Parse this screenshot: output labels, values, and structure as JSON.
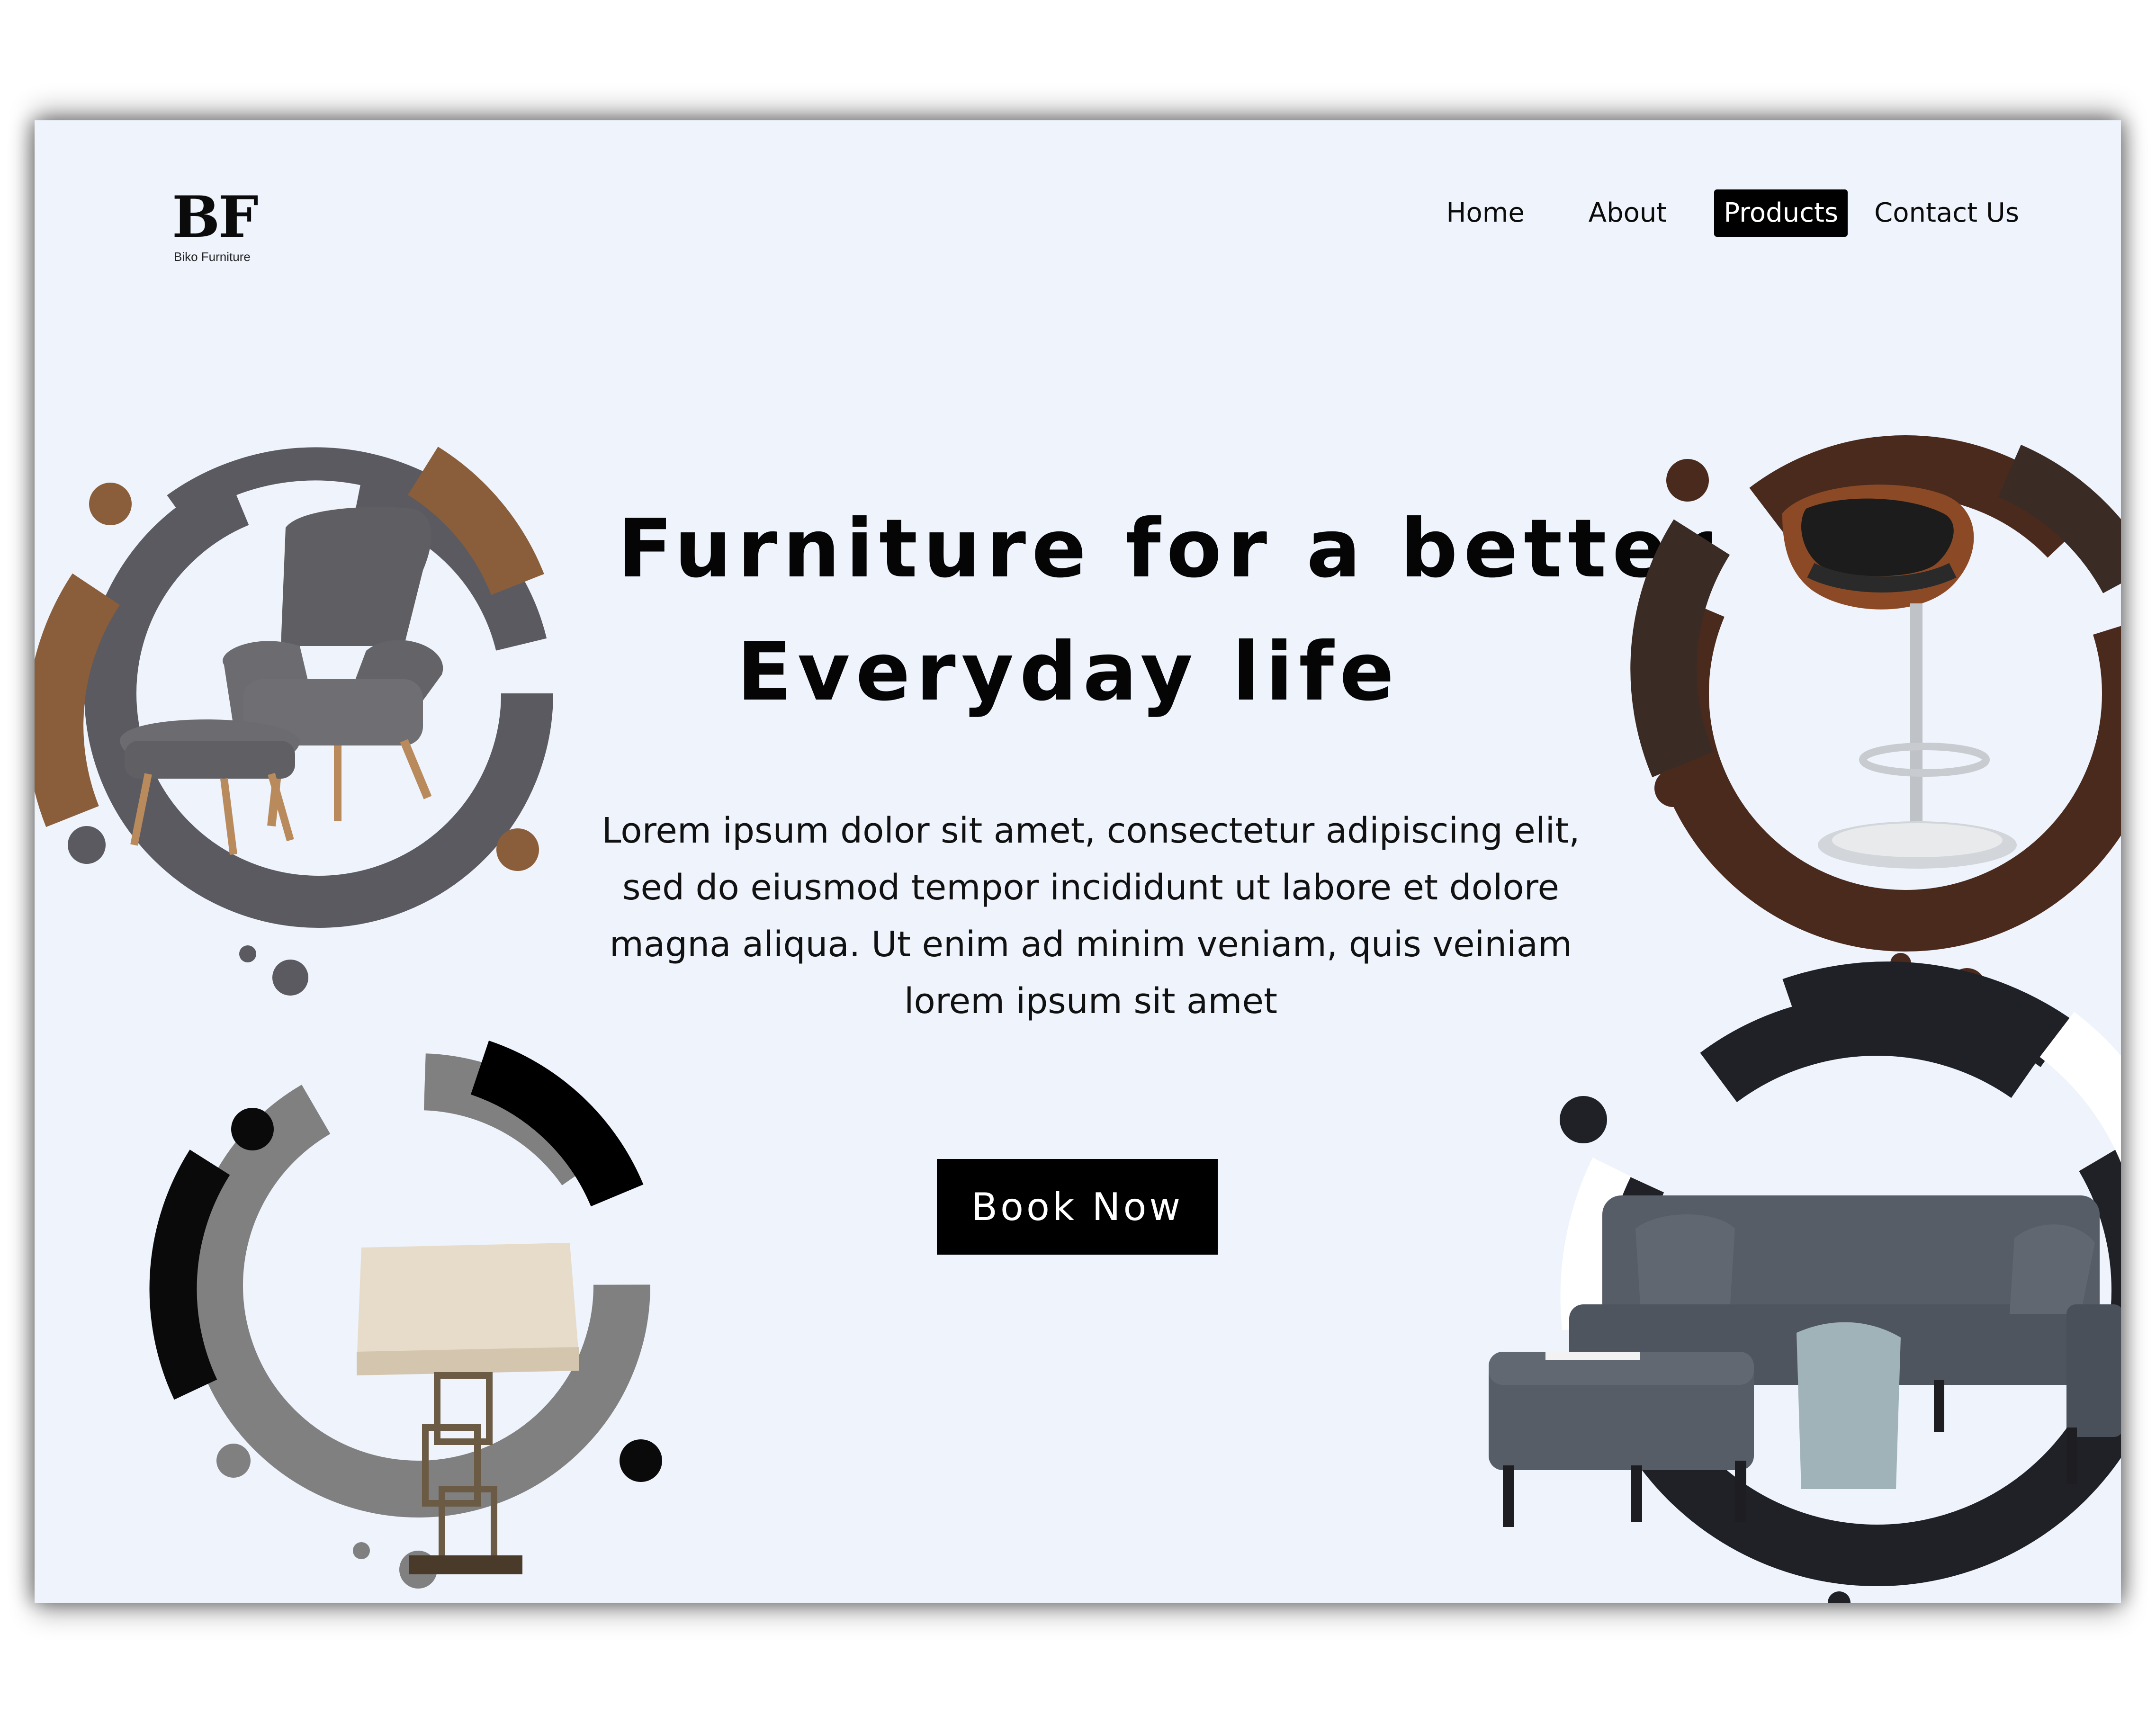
{
  "brand": {
    "mark": "BF",
    "name": "Biko Furniture"
  },
  "nav": {
    "items": [
      {
        "label": "Home"
      },
      {
        "label": "About"
      },
      {
        "label": "Products",
        "active": true
      },
      {
        "label": "Contact Us"
      }
    ]
  },
  "hero": {
    "title_line1": "Furniture for a better",
    "title_line2": "Everyday life",
    "body": "Lorem ipsum dolor sit amet, consectetur adipiscing elit, sed do eiusmod tempor incididunt ut labore et dolore magna aliqua. Ut enim ad minim veniam, quis veiniam lorem ipsum sit amet",
    "cta_label": "Book Now"
  },
  "colors": {
    "page_background": "#eef3fc",
    "text": "#050505",
    "button_bg": "#000000",
    "button_text": "#ffffff",
    "ring_gray": "#5a5a60",
    "ring_tan": "#8a5e3a",
    "ring_brown": "#4b2a1e",
    "ring_silver": "#808080",
    "ring_dark": "#202127"
  },
  "products": [
    {
      "icon": "armchair-with-ottoman-image"
    },
    {
      "icon": "bar-stool-image"
    },
    {
      "icon": "table-lamp-image"
    },
    {
      "icon": "sectional-sofa-image"
    }
  ]
}
